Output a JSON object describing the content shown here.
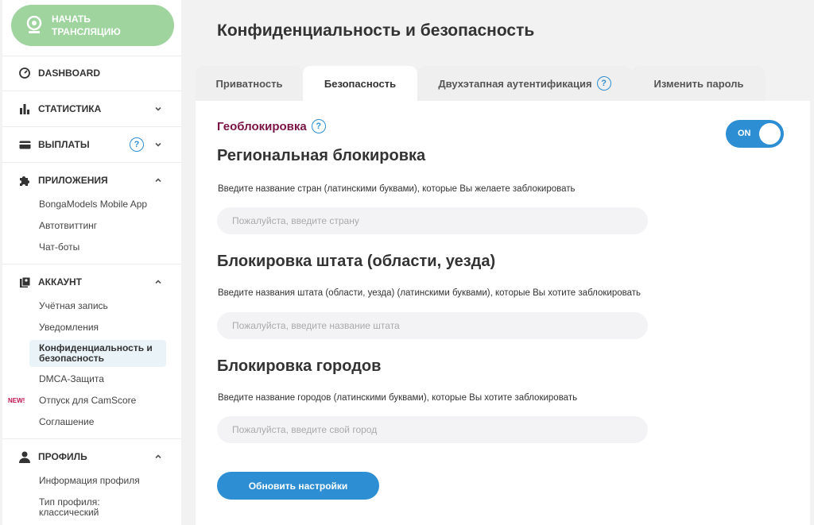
{
  "sidebar": {
    "stream_button": "НАЧАТЬ ТРАНСЛЯЦИЮ",
    "dashboard": "DASHBOARD",
    "statistics": "СТАТИСТИКА",
    "payouts": "ВЫПЛАТЫ",
    "payouts_help": "?",
    "apps": {
      "label": "ПРИЛОЖЕНИЯ",
      "items": [
        "BongaModels Mobile App",
        "Автотвиттинг",
        "Чат-боты"
      ]
    },
    "account": {
      "label": "АККАУНТ",
      "items": [
        "Учётная запись",
        "Уведомления",
        "Конфиденциальность и безопасность",
        "DMCA-Защита",
        "Отпуск для CamScore",
        "Соглашение"
      ],
      "new_badge": "NEW!"
    },
    "profile": {
      "label": "ПРОФИЛЬ",
      "items": [
        "Информация профиля",
        "Тип профиля: классический"
      ]
    }
  },
  "main": {
    "title": "Конфиденциальность и безопасность",
    "tabs": [
      {
        "label": "Приватность",
        "help": ""
      },
      {
        "label": "Безопасность",
        "help": ""
      },
      {
        "label": "Двухэтапная аутентификация",
        "help": "?"
      },
      {
        "label": "Изменить пароль",
        "help": ""
      }
    ],
    "active_tab": 1,
    "geo": {
      "title": "Геоблокировка",
      "help": "?",
      "toggle_label": "ON",
      "toggle_on": true
    },
    "regional": {
      "heading": "Региональная блокировка",
      "desc": "Введите название стран (латинскими буквами), которые Вы желаете заблокировать",
      "placeholder": "Пожалуйста, введите страну",
      "value": ""
    },
    "state": {
      "heading": "Блокировка штата (области, уезда)",
      "desc": "Введите названия штата (области, уезда) (латинскими буквами), которые Вы хотите заблокировать",
      "placeholder": "Пожалуйста, введите название штата",
      "value": ""
    },
    "city": {
      "heading": "Блокировка городов",
      "desc": "Введите название городов (латинскими буквами), которые Вы хотите заблокировать",
      "placeholder": "Пожалуйста, введите свой город",
      "value": ""
    },
    "submit_label": "Обновить настройки"
  },
  "colors": {
    "accent": "#2d8ed3",
    "stream_green": "#9fd49f",
    "geo_title": "#7a1346",
    "new_badge": "#c0134a"
  }
}
